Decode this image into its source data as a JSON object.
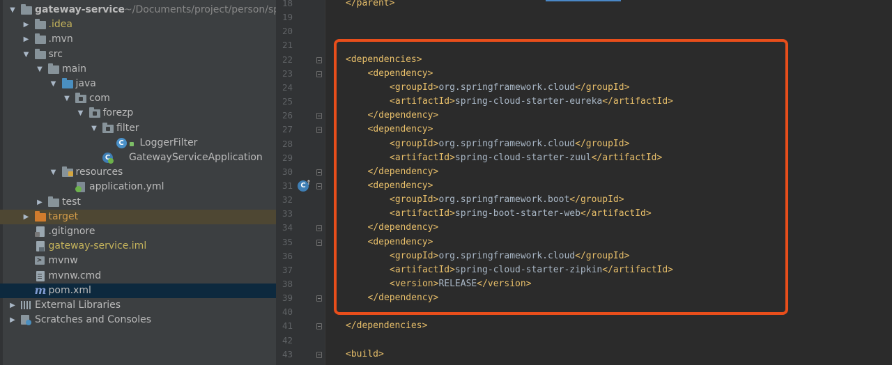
{
  "tree": {
    "rows": [
      {
        "depth": 0,
        "arrow": "open",
        "icon": "module-folder",
        "label": "gateway-service",
        "path": "~/Documents/project/person/sp",
        "bold": true
      },
      {
        "depth": 1,
        "arrow": "closed",
        "icon": "folder",
        "label": ".idea",
        "color": "#c5b35b"
      },
      {
        "depth": 1,
        "arrow": "closed",
        "icon": "folder",
        "label": ".mvn"
      },
      {
        "depth": 1,
        "arrow": "open",
        "icon": "folder",
        "label": "src"
      },
      {
        "depth": 2,
        "arrow": "open",
        "icon": "folder",
        "label": "main"
      },
      {
        "depth": 3,
        "arrow": "open",
        "icon": "folder-blue",
        "label": "java"
      },
      {
        "depth": 4,
        "arrow": "open",
        "icon": "package",
        "label": "com"
      },
      {
        "depth": 5,
        "arrow": "open",
        "icon": "package",
        "label": "forezp"
      },
      {
        "depth": 6,
        "arrow": "open",
        "icon": "package",
        "label": "filter"
      },
      {
        "depth": 7,
        "arrow": "none",
        "icon": "class",
        "label": "LoggerFilter"
      },
      {
        "depth": 6,
        "arrow": "none",
        "icon": "spring-class",
        "label": "GatewayServiceApplication"
      },
      {
        "depth": 3,
        "arrow": "open",
        "icon": "resources-folder",
        "label": "resources"
      },
      {
        "depth": 4,
        "arrow": "none",
        "icon": "yml-file",
        "label": "application.yml"
      },
      {
        "depth": 2,
        "arrow": "closed",
        "icon": "folder",
        "label": "test"
      },
      {
        "depth": 1,
        "arrow": "closed",
        "icon": "folder-orange",
        "label": "target",
        "color": "#d19a48",
        "excluded": true
      },
      {
        "depth": 1,
        "arrow": "none",
        "icon": "gitignore-file",
        "label": ".gitignore"
      },
      {
        "depth": 1,
        "arrow": "none",
        "icon": "iml-file",
        "label": "gateway-service.iml",
        "color": "#c5b35b"
      },
      {
        "depth": 1,
        "arrow": "none",
        "icon": "script-file",
        "label": "mvnw"
      },
      {
        "depth": 1,
        "arrow": "none",
        "icon": "text-file",
        "label": "mvnw.cmd"
      },
      {
        "depth": 1,
        "arrow": "none",
        "icon": "maven-file",
        "label": "pom.xml",
        "selected": true
      },
      {
        "depth": 0,
        "arrow": "closed",
        "icon": "libraries",
        "label": "External Libraries"
      },
      {
        "depth": 0,
        "arrow": "closed",
        "icon": "scratches",
        "label": "Scratches and Consoles"
      }
    ]
  },
  "editor": {
    "lines": [
      {
        "n": "18",
        "segments": [
          {
            "t": "tag",
            "v": "</parent>"
          }
        ],
        "indent": 0
      },
      {
        "n": "19",
        "segments": [],
        "indent": 0
      },
      {
        "n": "20",
        "segments": [],
        "indent": 0
      },
      {
        "n": "21",
        "segments": [],
        "indent": 0
      },
      {
        "n": "22",
        "segments": [
          {
            "t": "tag",
            "v": "<dependencies>"
          }
        ],
        "indent": 0,
        "fold": true
      },
      {
        "n": "23",
        "segments": [
          {
            "t": "tag",
            "v": "<dependency>"
          }
        ],
        "indent": 1,
        "fold": true
      },
      {
        "n": "24",
        "segments": [
          {
            "t": "tag",
            "v": "<groupId>"
          },
          {
            "t": "txt",
            "v": "org.springframework.cloud"
          },
          {
            "t": "tag",
            "v": "</groupId>"
          }
        ],
        "indent": 2
      },
      {
        "n": "25",
        "segments": [
          {
            "t": "tag",
            "v": "<artifactId>"
          },
          {
            "t": "txt",
            "v": "spring-cloud-starter-eureka"
          },
          {
            "t": "tag",
            "v": "</artifactId>"
          }
        ],
        "indent": 2
      },
      {
        "n": "26",
        "segments": [
          {
            "t": "tag",
            "v": "</dependency>"
          }
        ],
        "indent": 1,
        "fold": true
      },
      {
        "n": "27",
        "segments": [
          {
            "t": "tag",
            "v": "<dependency>"
          }
        ],
        "indent": 1,
        "fold": true
      },
      {
        "n": "28",
        "segments": [
          {
            "t": "tag",
            "v": "<groupId>"
          },
          {
            "t": "txt",
            "v": "org.springframework.cloud"
          },
          {
            "t": "tag",
            "v": "</groupId>"
          }
        ],
        "indent": 2
      },
      {
        "n": "29",
        "segments": [
          {
            "t": "tag",
            "v": "<artifactId>"
          },
          {
            "t": "txt",
            "v": "spring-cloud-starter-zuul"
          },
          {
            "t": "tag",
            "v": "</artifactId>"
          }
        ],
        "indent": 2
      },
      {
        "n": "30",
        "segments": [
          {
            "t": "tag",
            "v": "</dependency>"
          }
        ],
        "indent": 1,
        "fold": true
      },
      {
        "n": "31",
        "segments": [
          {
            "t": "tag",
            "v": "<dependency>"
          }
        ],
        "indent": 1,
        "fold": true
      },
      {
        "n": "32",
        "segments": [
          {
            "t": "tag",
            "v": "<groupId>"
          },
          {
            "t": "txt",
            "v": "org.springframework.boot"
          },
          {
            "t": "tag",
            "v": "</groupId>"
          }
        ],
        "indent": 2
      },
      {
        "n": "33",
        "segments": [
          {
            "t": "tag",
            "v": "<artifactId>"
          },
          {
            "t": "txt",
            "v": "spring-boot-starter-web"
          },
          {
            "t": "tag",
            "v": "</artifactId>"
          }
        ],
        "indent": 2
      },
      {
        "n": "34",
        "segments": [
          {
            "t": "tag",
            "v": "</dependency>"
          }
        ],
        "indent": 1,
        "fold": true
      },
      {
        "n": "35",
        "segments": [
          {
            "t": "tag",
            "v": "<dependency>"
          }
        ],
        "indent": 1,
        "fold": true
      },
      {
        "n": "36",
        "segments": [
          {
            "t": "tag",
            "v": "<groupId>"
          },
          {
            "t": "txt",
            "v": "org.springframework.cloud"
          },
          {
            "t": "tag",
            "v": "</groupId>"
          }
        ],
        "indent": 2
      },
      {
        "n": "37",
        "segments": [
          {
            "t": "tag",
            "v": "<artifactId>"
          },
          {
            "t": "txt",
            "v": "spring-cloud-starter-zipkin"
          },
          {
            "t": "tag",
            "v": "</artifactId>"
          }
        ],
        "indent": 2
      },
      {
        "n": "38",
        "segments": [
          {
            "t": "tag",
            "v": "<version>"
          },
          {
            "t": "txt",
            "v": "RELEASE"
          },
          {
            "t": "tag",
            "v": "</version>"
          }
        ],
        "indent": 2
      },
      {
        "n": "39",
        "segments": [
          {
            "t": "tag",
            "v": "</dependency>"
          }
        ],
        "indent": 1,
        "fold": true
      },
      {
        "n": "40",
        "segments": [],
        "indent": 0
      },
      {
        "n": "41",
        "segments": [
          {
            "t": "tag",
            "v": "</dependencies>"
          }
        ],
        "indent": 0,
        "fold": true
      },
      {
        "n": "42",
        "segments": [],
        "indent": 0
      },
      {
        "n": "43",
        "segments": [
          {
            "t": "tag",
            "v": "<build>"
          }
        ],
        "indent": 0,
        "fold": true
      }
    ],
    "gutter_icon_line": "31",
    "gutter_icon": "spring-boot-icon",
    "highlight_color": "#e84e1b"
  },
  "colors": {
    "tag": "#e8bf6a",
    "text": "#a9b7c6",
    "selection": "#0d293e"
  }
}
